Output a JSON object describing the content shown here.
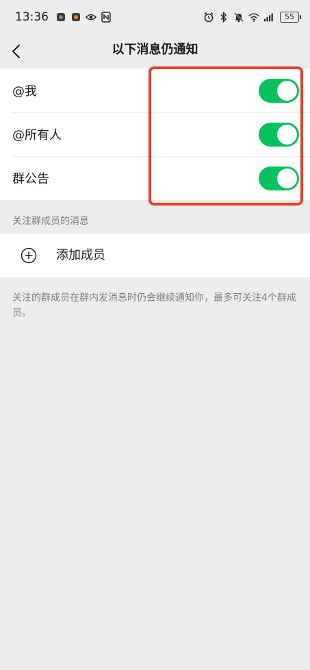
{
  "status_bar": {
    "time": "13:36",
    "battery": "55",
    "icons": [
      "app-icon",
      "app-icon",
      "eye-icon",
      "nfc-icon",
      "alarm-icon",
      "bluetooth-icon",
      "mute-icon",
      "wifi-icon",
      "signal-icon",
      "battery-icon"
    ]
  },
  "nav": {
    "title": "以下消息仍通知",
    "back_icon": "chevron-left-icon"
  },
  "settings": {
    "items": [
      {
        "label": "@我",
        "enabled": true
      },
      {
        "label": "@所有人",
        "enabled": true
      },
      {
        "label": "群公告",
        "enabled": true
      }
    ]
  },
  "members": {
    "section_title": "关注群成员的消息",
    "add_label": "添加成员",
    "add_icon": "plus-circle-icon",
    "note": "关注的群成员在群内发消息时仍会继续通知你，最多可关注4个群成员。"
  },
  "colors": {
    "accent": "#07c160",
    "highlight": "#e5402f",
    "background": "#ededed"
  }
}
